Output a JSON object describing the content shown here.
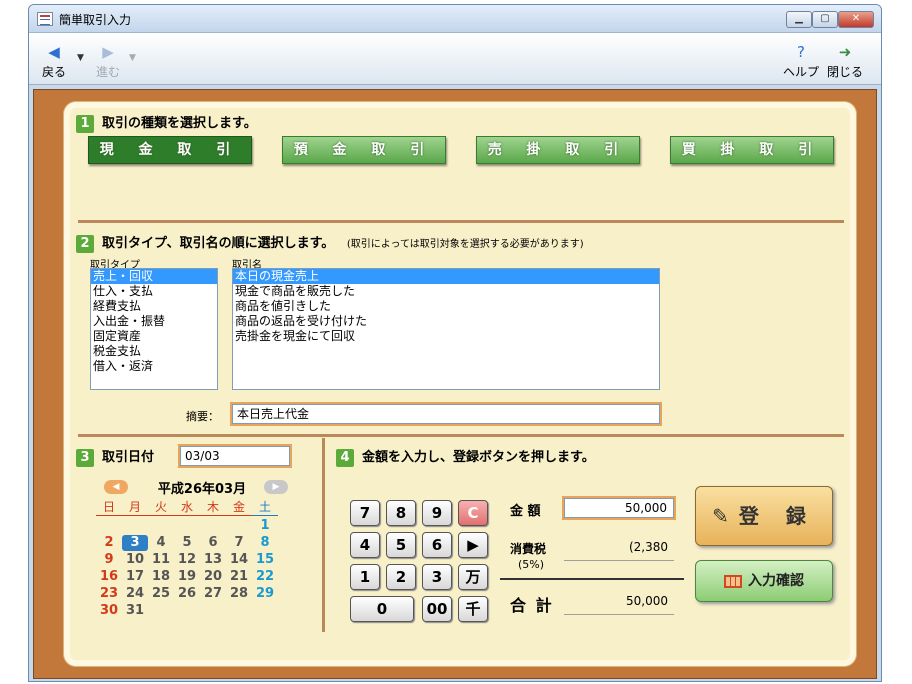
{
  "window": {
    "title": "簡単取引入力"
  },
  "toolbar": {
    "back": "戻る",
    "forward": "進む",
    "help": "ヘルプ",
    "close": "閉じる"
  },
  "section1": {
    "num": "1",
    "title": "取引の種類を選択します。",
    "buttons": [
      {
        "label": "現 金 取 引",
        "selected": true
      },
      {
        "label": "預 金 取 引",
        "selected": false
      },
      {
        "label": "売 掛 取 引",
        "selected": false
      },
      {
        "label": "買 掛 取 引",
        "selected": false
      }
    ]
  },
  "section2": {
    "num": "2",
    "title": "取引タイプ、取引名の順に選択します。",
    "note": "(取引によっては取引対象を選択する必要があります)",
    "type_label": "取引タイプ",
    "name_label": "取引名",
    "types": [
      "売上・回収",
      "仕入・支払",
      "経費支払",
      "入出金・振替",
      "固定資産",
      "税金支払",
      "借入・返済"
    ],
    "names": [
      "本日の現金売上",
      "現金で商品を販売した",
      "商品を値引きした",
      "商品の返品を受け付けた",
      "売掛金を現金にて回収"
    ],
    "memo_label": "摘要：",
    "memo_value": "本日売上代金"
  },
  "section3": {
    "num": "3",
    "title": "取引日付",
    "date_value": "03/03",
    "calendar": {
      "title": "平成26年03月",
      "weekdays": [
        "日",
        "月",
        "火",
        "水",
        "木",
        "金",
        "土"
      ],
      "weeks": [
        [
          "",
          "",
          "",
          "",
          "",
          "",
          "1"
        ],
        [
          "2",
          "3",
          "4",
          "5",
          "6",
          "7",
          "8"
        ],
        [
          "9",
          "10",
          "11",
          "12",
          "13",
          "14",
          "15"
        ],
        [
          "16",
          "17",
          "18",
          "19",
          "20",
          "21",
          "22"
        ],
        [
          "23",
          "24",
          "25",
          "26",
          "27",
          "28",
          "29"
        ],
        [
          "30",
          "31",
          "",
          "",
          "",
          "",
          ""
        ]
      ],
      "today": "3"
    }
  },
  "section4": {
    "num": "4",
    "title": "金額を入力し、登録ボタンを押します。",
    "keys": [
      "7",
      "8",
      "9",
      "C",
      "4",
      "5",
      "6",
      "▶",
      "1",
      "2",
      "3",
      "万",
      "0",
      "00",
      "千"
    ],
    "amount_label": "金 額",
    "amount_value": "50,000",
    "tax_label": "消費税",
    "tax_rate": "(5%)",
    "tax_value": "(2,380",
    "total_label": "合 計",
    "total_value": "50,000",
    "register_label": "登 録",
    "confirm_label": "入力確認"
  },
  "colors": {
    "accent_green": "#5caa3a",
    "selected_green": "#2e7d2a",
    "frame_brown": "#c2783a",
    "panel_bg": "#f8f0c9",
    "highlight": "#3399ff"
  }
}
